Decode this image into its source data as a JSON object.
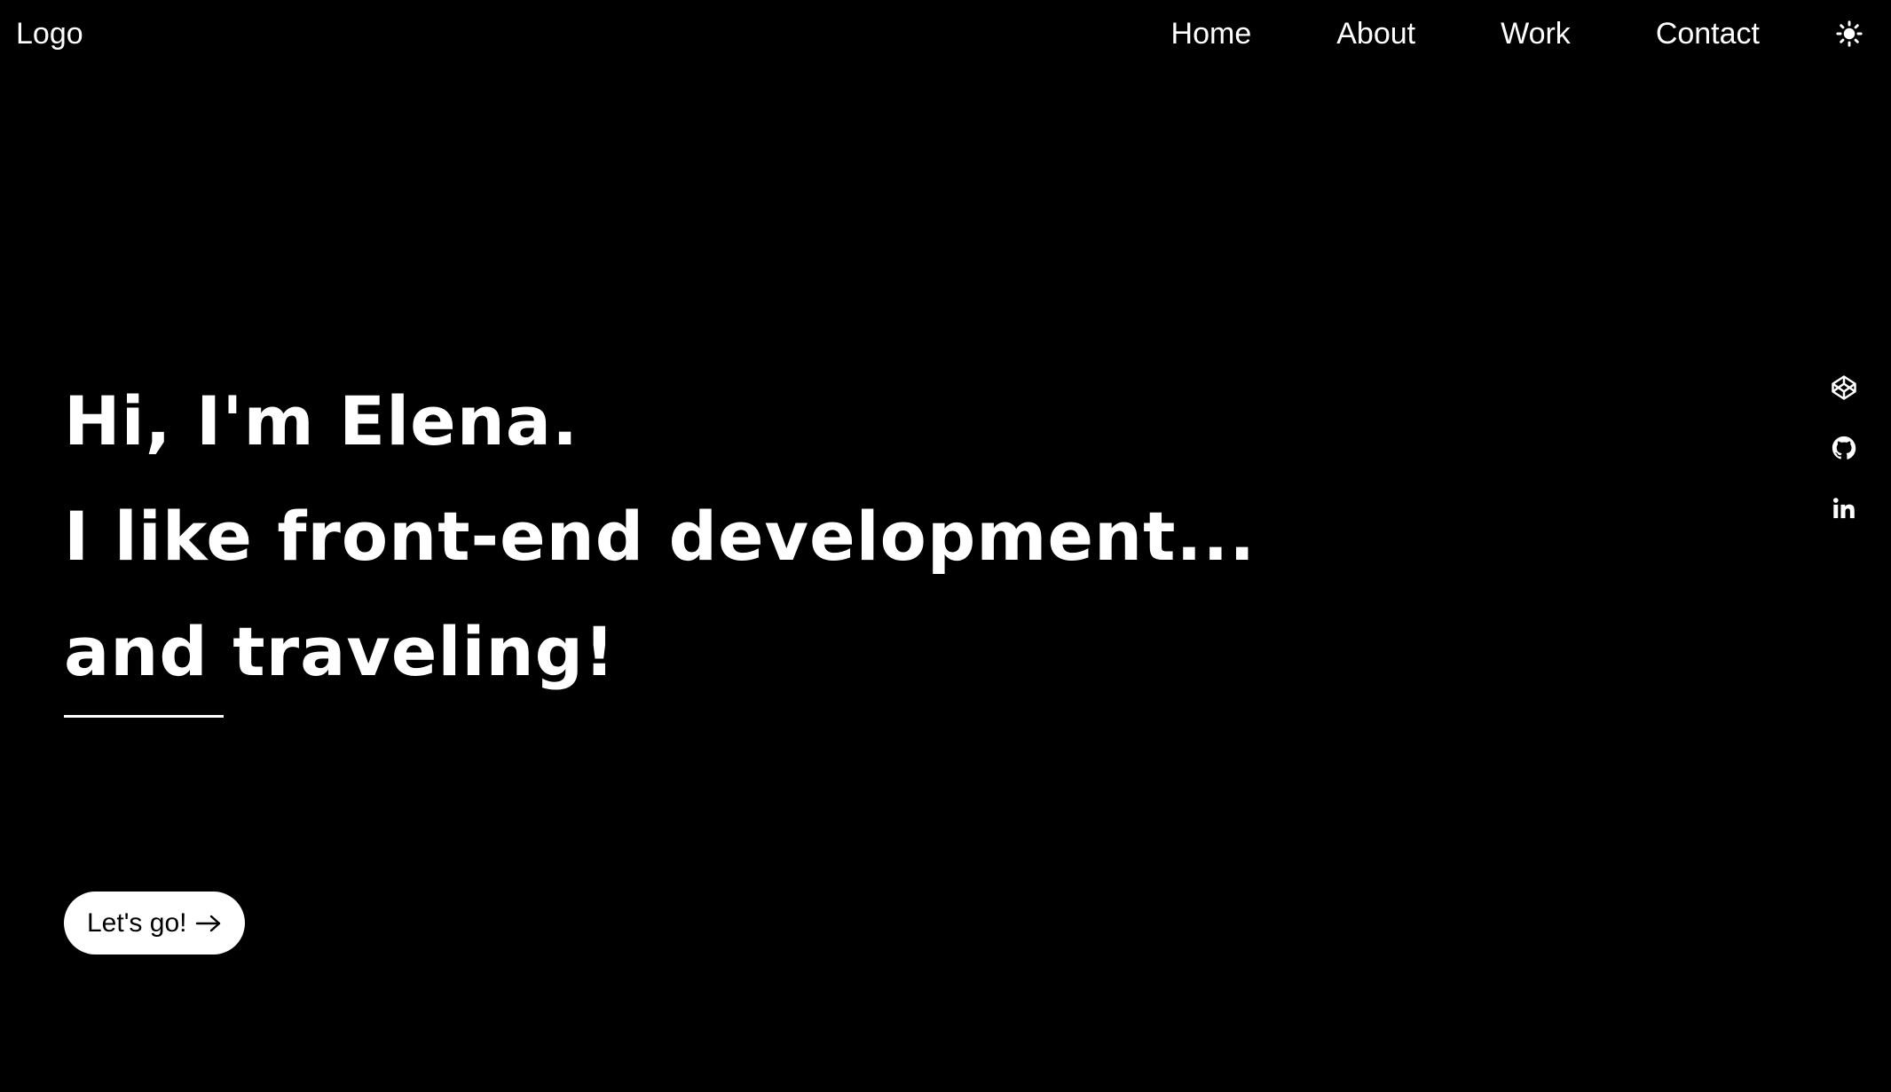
{
  "header": {
    "logo": "Logo",
    "nav": [
      {
        "label": "Home"
      },
      {
        "label": "About"
      },
      {
        "label": "Work"
      },
      {
        "label": "Contact"
      }
    ],
    "theme_icon": "sun-icon"
  },
  "hero": {
    "lines": [
      "Hi, I'm Elena.",
      "I like front-end development...",
      "and traveling!"
    ],
    "cta_label": "Let's go!",
    "cta_icon": "arrow-right-icon"
  },
  "social": [
    {
      "icon": "codepen-icon"
    },
    {
      "icon": "github-icon"
    },
    {
      "icon": "linkedin-icon"
    }
  ],
  "colors": {
    "background": "#000000",
    "foreground": "#ffffff",
    "button_text": "#000000"
  }
}
